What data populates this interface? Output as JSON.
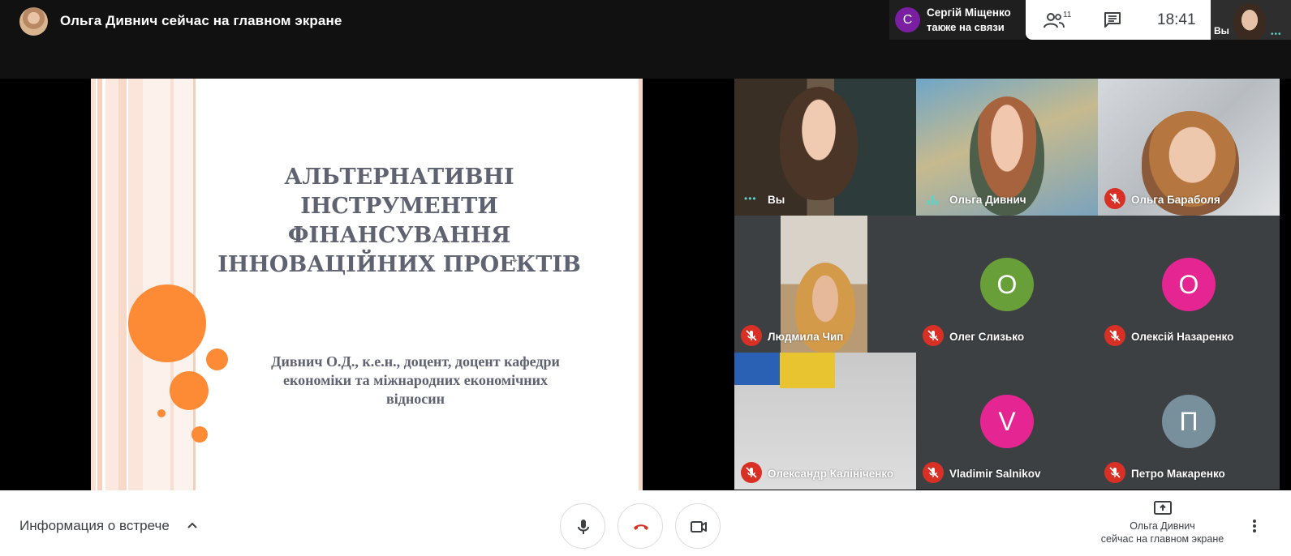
{
  "header": {
    "presenting_title": "Ольга Дивнич сейчас на главном экране",
    "joined_toast": {
      "initial": "С",
      "name": "Сергій Міщенко",
      "status": "также на связи"
    },
    "participant_count": "11",
    "clock": "18:41",
    "self_label": "Вы"
  },
  "slide": {
    "title_lines": [
      "АЛЬТЕРНАТИВНІ",
      "ІНСТРУМЕНТИ",
      "ФІНАНСУВАННЯ",
      "ІННОВАЦІЙНИХ ПРОЕКТІВ"
    ],
    "subtitle_lines": [
      "Дивнич О.Д., к.е.н., доцент, доцент кафедри",
      "економіки та міжнародних економічних",
      "відносин"
    ],
    "accent_color": "#fd8a34"
  },
  "participants": [
    {
      "name": "Вы",
      "status": "speaking-dots"
    },
    {
      "name": "Ольга Дивнич",
      "status": "speaking"
    },
    {
      "name": "Ольга Бараболя",
      "status": "muted"
    },
    {
      "name": "Людмила Чип",
      "status": "muted"
    },
    {
      "name": "Олег Слизько",
      "status": "muted",
      "initial": "О",
      "avatar_color": "#689f38"
    },
    {
      "name": "Олексій Назаренко",
      "status": "muted",
      "initial": "О",
      "avatar_color": "#e52592"
    },
    {
      "name": "Олександр Калініченко",
      "status": "muted"
    },
    {
      "name": "Vladimir Salnikov",
      "status": "muted",
      "initial": "V",
      "avatar_color": "#e52592"
    },
    {
      "name": "Петро Макаренко",
      "status": "muted",
      "initial": "П",
      "avatar_color": "#78909c"
    }
  ],
  "footer": {
    "meeting_info": "Информация о встрече",
    "presenter_name": "Ольга Дивнич",
    "presenter_status": "сейчас на главном экране"
  },
  "colors": {
    "mute_red": "#d93025",
    "hangup_red": "#d93025",
    "speaking_teal": "#5bd3c6"
  }
}
